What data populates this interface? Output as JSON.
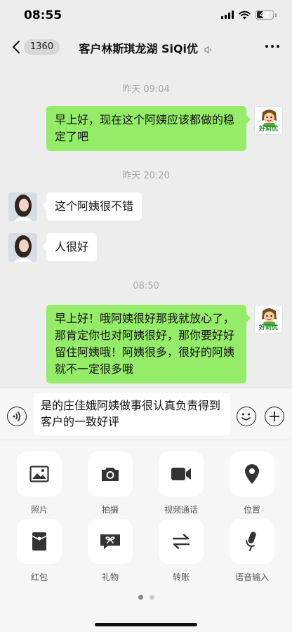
{
  "status_bar": {
    "time": "08:55",
    "battery": "47",
    "battery_level": 0.47
  },
  "nav": {
    "back_badge": "1360",
    "title": "客户林斯琪龙湖 SiQi优"
  },
  "chat": {
    "messages": [
      {
        "type": "timestamp",
        "text": "昨天 09:04"
      },
      {
        "type": "sent",
        "text": "早上好，现在这个阿姨应该都做的稳定了吧"
      },
      {
        "type": "timestamp",
        "text": "昨天 20:20"
      },
      {
        "type": "received",
        "text": "这个阿姨很不错"
      },
      {
        "type": "received",
        "text": "人很好"
      },
      {
        "type": "timestamp",
        "text": "08:50"
      },
      {
        "type": "sent",
        "text": "早上好！哦阿姨很好那我就放心了，那肯定你也对阿姨很好，那你要好好留住阿姨哦！阿姨很多，很好的阿姨就不一定很多哦"
      }
    ],
    "self_avatar_label": "好莉优"
  },
  "input": {
    "value": "是的庄佳娥阿姨做事很认真负责得到客户的一致好评"
  },
  "panel": {
    "items": [
      {
        "label": "照片",
        "icon": "photo-icon"
      },
      {
        "label": "拍摄",
        "icon": "camera-icon"
      },
      {
        "label": "视频通话",
        "icon": "video-call-icon"
      },
      {
        "label": "位置",
        "icon": "location-icon"
      },
      {
        "label": "红包",
        "icon": "red-packet-icon"
      },
      {
        "label": "礼物",
        "icon": "gift-icon"
      },
      {
        "label": "转账",
        "icon": "transfer-icon"
      },
      {
        "label": "语音输入",
        "icon": "microphone-icon"
      }
    ],
    "page_count": 2,
    "current_page": 1
  },
  "colors": {
    "bubble_sent": "#95ec69",
    "bubble_received": "#ffffff",
    "background": "#ededed"
  }
}
